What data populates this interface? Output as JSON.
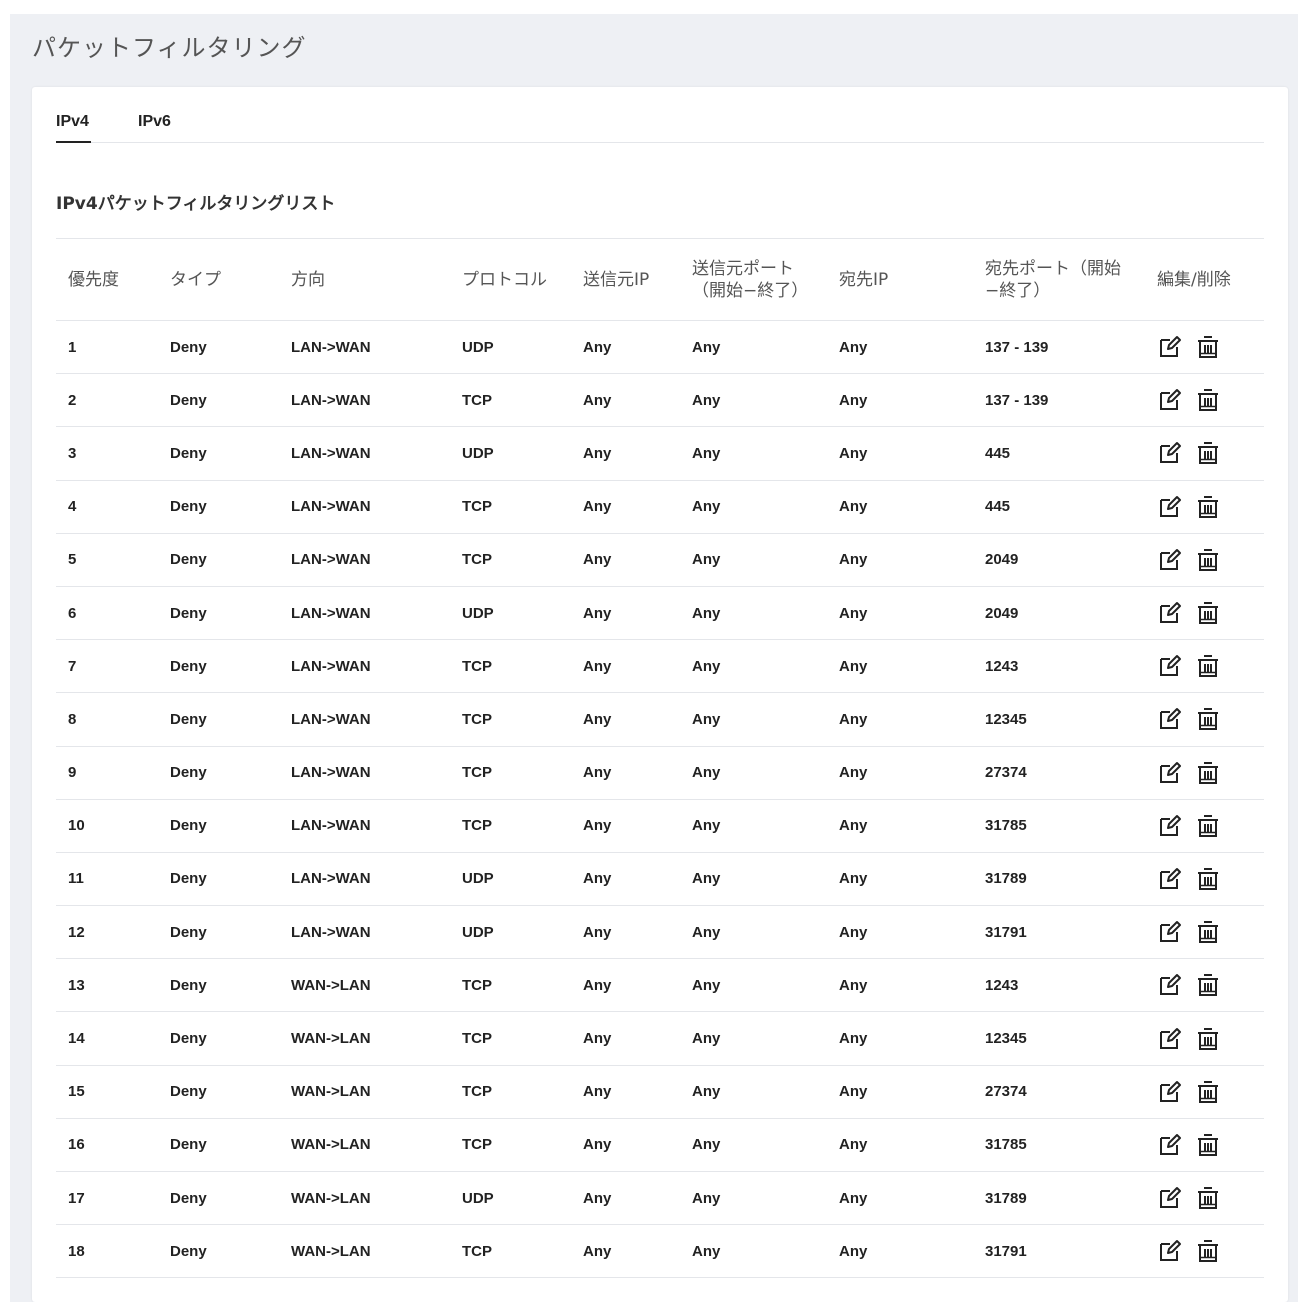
{
  "page": {
    "title": "パケットフィルタリング"
  },
  "tabs": [
    {
      "label": "IPv4",
      "active": true
    },
    {
      "label": "IPv6",
      "active": false
    }
  ],
  "list": {
    "title": "IPv4パケットフィルタリングリスト",
    "columns": [
      "優先度",
      "タイプ",
      "方向",
      "プロトコル",
      "送信元IP",
      "送信元ポート（開始−終了）",
      "宛先IP",
      "宛先ポート（開始−終了）",
      "編集/削除"
    ],
    "rows": [
      {
        "priority": "1",
        "type": "Deny",
        "direction": "LAN->WAN",
        "protocol": "UDP",
        "src_ip": "Any",
        "src_port": "Any",
        "dst_ip": "Any",
        "dst_port": "137 - 139"
      },
      {
        "priority": "2",
        "type": "Deny",
        "direction": "LAN->WAN",
        "protocol": "TCP",
        "src_ip": "Any",
        "src_port": "Any",
        "dst_ip": "Any",
        "dst_port": "137 - 139"
      },
      {
        "priority": "3",
        "type": "Deny",
        "direction": "LAN->WAN",
        "protocol": "UDP",
        "src_ip": "Any",
        "src_port": "Any",
        "dst_ip": "Any",
        "dst_port": "445"
      },
      {
        "priority": "4",
        "type": "Deny",
        "direction": "LAN->WAN",
        "protocol": "TCP",
        "src_ip": "Any",
        "src_port": "Any",
        "dst_ip": "Any",
        "dst_port": "445"
      },
      {
        "priority": "5",
        "type": "Deny",
        "direction": "LAN->WAN",
        "protocol": "TCP",
        "src_ip": "Any",
        "src_port": "Any",
        "dst_ip": "Any",
        "dst_port": "2049"
      },
      {
        "priority": "6",
        "type": "Deny",
        "direction": "LAN->WAN",
        "protocol": "UDP",
        "src_ip": "Any",
        "src_port": "Any",
        "dst_ip": "Any",
        "dst_port": "2049"
      },
      {
        "priority": "7",
        "type": "Deny",
        "direction": "LAN->WAN",
        "protocol": "TCP",
        "src_ip": "Any",
        "src_port": "Any",
        "dst_ip": "Any",
        "dst_port": "1243"
      },
      {
        "priority": "8",
        "type": "Deny",
        "direction": "LAN->WAN",
        "protocol": "TCP",
        "src_ip": "Any",
        "src_port": "Any",
        "dst_ip": "Any",
        "dst_port": "12345"
      },
      {
        "priority": "9",
        "type": "Deny",
        "direction": "LAN->WAN",
        "protocol": "TCP",
        "src_ip": "Any",
        "src_port": "Any",
        "dst_ip": "Any",
        "dst_port": "27374"
      },
      {
        "priority": "10",
        "type": "Deny",
        "direction": "LAN->WAN",
        "protocol": "TCP",
        "src_ip": "Any",
        "src_port": "Any",
        "dst_ip": "Any",
        "dst_port": "31785"
      },
      {
        "priority": "11",
        "type": "Deny",
        "direction": "LAN->WAN",
        "protocol": "UDP",
        "src_ip": "Any",
        "src_port": "Any",
        "dst_ip": "Any",
        "dst_port": "31789"
      },
      {
        "priority": "12",
        "type": "Deny",
        "direction": "LAN->WAN",
        "protocol": "UDP",
        "src_ip": "Any",
        "src_port": "Any",
        "dst_ip": "Any",
        "dst_port": "31791"
      },
      {
        "priority": "13",
        "type": "Deny",
        "direction": "WAN->LAN",
        "protocol": "TCP",
        "src_ip": "Any",
        "src_port": "Any",
        "dst_ip": "Any",
        "dst_port": "1243"
      },
      {
        "priority": "14",
        "type": "Deny",
        "direction": "WAN->LAN",
        "protocol": "TCP",
        "src_ip": "Any",
        "src_port": "Any",
        "dst_ip": "Any",
        "dst_port": "12345"
      },
      {
        "priority": "15",
        "type": "Deny",
        "direction": "WAN->LAN",
        "protocol": "TCP",
        "src_ip": "Any",
        "src_port": "Any",
        "dst_ip": "Any",
        "dst_port": "27374"
      },
      {
        "priority": "16",
        "type": "Deny",
        "direction": "WAN->LAN",
        "protocol": "TCP",
        "src_ip": "Any",
        "src_port": "Any",
        "dst_ip": "Any",
        "dst_port": "31785"
      },
      {
        "priority": "17",
        "type": "Deny",
        "direction": "WAN->LAN",
        "protocol": "UDP",
        "src_ip": "Any",
        "src_port": "Any",
        "dst_ip": "Any",
        "dst_port": "31789"
      },
      {
        "priority": "18",
        "type": "Deny",
        "direction": "WAN->LAN",
        "protocol": "TCP",
        "src_ip": "Any",
        "src_port": "Any",
        "dst_ip": "Any",
        "dst_port": "31791"
      }
    ]
  },
  "icons": {
    "edit": "edit-icon",
    "delete": "trash-icon"
  }
}
